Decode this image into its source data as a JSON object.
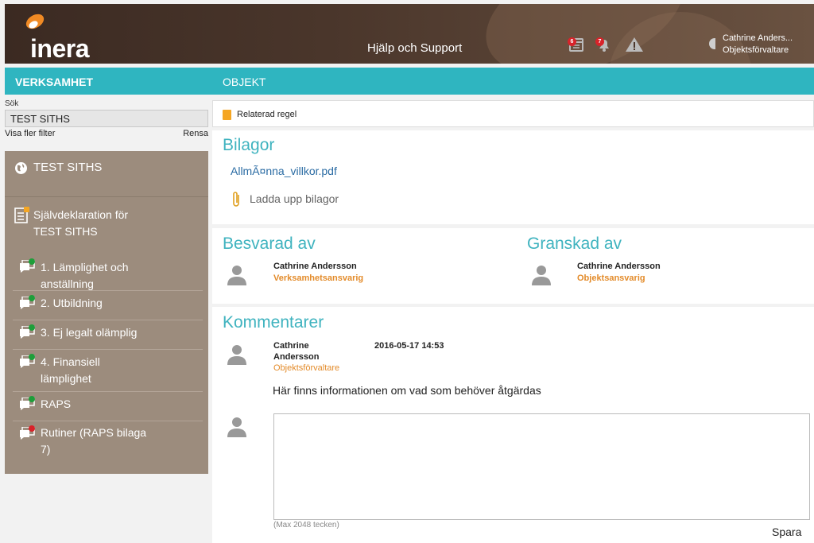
{
  "header": {
    "logo_text": "inera",
    "help_label": "Hjälp och Support",
    "calendar_badge": "6",
    "bell_badge": "7",
    "user_name": "Cathrine Anders...",
    "user_role": "Objektsförvaltare"
  },
  "topbar": {
    "left": "VERKSAMHET",
    "right": "OBJEKT"
  },
  "sidebar": {
    "search_label": "Sök",
    "search_value": "TEST SITHS",
    "more_filters": "Visa fler filter",
    "clear": "Rensa",
    "org": "TEST SITHS",
    "declaration_line1": "Självdeklaration för",
    "declaration_line2": "TEST SITHS",
    "items": [
      {
        "label_line1": "1. Lämplighet och",
        "label_line2": "anställning",
        "status_color": "#1e9e3a"
      },
      {
        "label_line1": "2. Utbildning",
        "label_line2": "",
        "status_color": "#1e9e3a"
      },
      {
        "label_line1": "3. Ej legalt olämplig",
        "label_line2": "",
        "status_color": "#1e9e3a"
      },
      {
        "label_line1": "4. Finansiell",
        "label_line2": "lämplighet",
        "status_color": "#1e9e3a"
      },
      {
        "label_line1": "RAPS",
        "label_line2": "",
        "status_color": "#1e9e3a"
      },
      {
        "label_line1": "Rutiner (RAPS bilaga",
        "label_line2": "7)",
        "status_color": "#d8232a"
      }
    ]
  },
  "main": {
    "related_rule": "Relaterad regel",
    "attachments_title": "Bilagor",
    "attachment_file": "AllmÃ¤nna_villkor.pdf",
    "upload_label": "Ladda upp bilagor",
    "answered_title": "Besvarad av",
    "answered_name": "Cathrine Andersson",
    "answered_role": "Verksamhetsansvarig",
    "reviewed_title": "Granskad av",
    "reviewed_name": "Cathrine Andersson",
    "reviewed_role": "Objektsansvarig",
    "comments_title": "Kommentarer",
    "comment_name_line1": "Cathrine",
    "comment_name_line2": "Andersson",
    "comment_role": "Objektsförvaltare",
    "comment_time": "2016-05-17 14:53",
    "comment_text": "Här finns informationen om vad som behöver åtgärdas",
    "max_hint": "(Max 2048 tecken)",
    "save_label": "Spara"
  },
  "colors": {
    "accent": "#2fb5c0",
    "heading": "#3fb3bf",
    "role": "#e38b2a",
    "sidebar": "#9c8c7d"
  }
}
